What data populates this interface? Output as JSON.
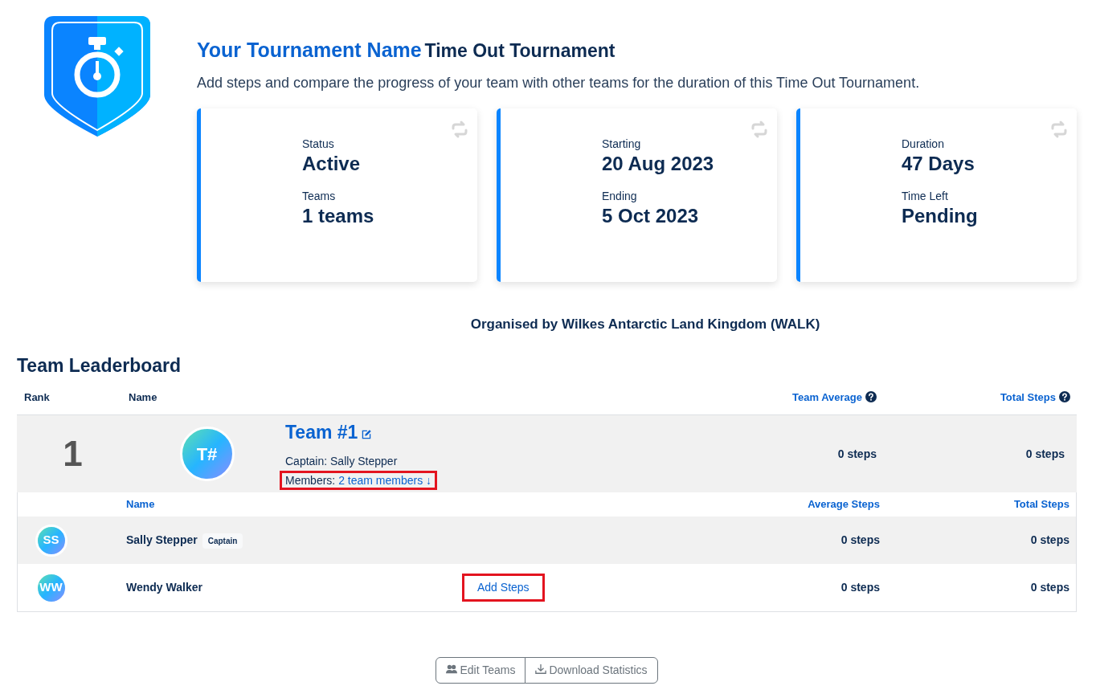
{
  "header": {
    "title": "Your Tournament Name",
    "name": "Time Out Tournament",
    "description": "Add steps and compare the progress of your team with other teams for the duration of this Time Out Tournament."
  },
  "cards": [
    {
      "fields": [
        {
          "label": "Status",
          "value": "Active"
        },
        {
          "label": "Teams",
          "value": "1 teams"
        }
      ]
    },
    {
      "fields": [
        {
          "label": "Starting",
          "value": "20 Aug 2023"
        },
        {
          "label": "Ending",
          "value": "5 Oct 2023"
        }
      ]
    },
    {
      "fields": [
        {
          "label": "Duration",
          "value": "47 Days"
        },
        {
          "label": "Time Left",
          "value": "Pending"
        }
      ]
    }
  ],
  "organiser": "Organised by **Wilkes Antarctic Land Kingdom (WALK)**",
  "leaderboard": {
    "title": "Team Leaderboard",
    "columns": [
      {
        "label": "Rank",
        "help": false
      },
      {
        "label": "Name",
        "help": false
      },
      {
        "label": "Team Average",
        "help": true
      },
      {
        "label": "Total Steps",
        "help": true
      }
    ],
    "teams": [
      {
        "rank": "1",
        "initials": "T#",
        "name": "Team #1",
        "captain": "Captain: Sally Stepper",
        "members_label": "Members:",
        "members_link": "2 team members ↓",
        "members_highlighted": true,
        "expanded": true,
        "average": "0 steps",
        "total": "0 steps",
        "member_columns": [
          "Name",
          "Average Steps",
          "Total Steps"
        ],
        "members": [
          {
            "initials": "SS",
            "name": "Sally Stepper",
            "badge": "Captain",
            "average": "0 steps",
            "total": "0 steps"
          },
          {
            "initials": "WW",
            "name": "Wendy Walker",
            "action": "Add Steps",
            "action_highlighted": true,
            "average": "0 steps",
            "total": "0 steps"
          }
        ]
      }
    ]
  },
  "buttons": [
    {
      "label": "Edit Teams",
      "kind": "users"
    },
    {
      "label": "Download Statistics",
      "kind": "download"
    }
  ]
}
